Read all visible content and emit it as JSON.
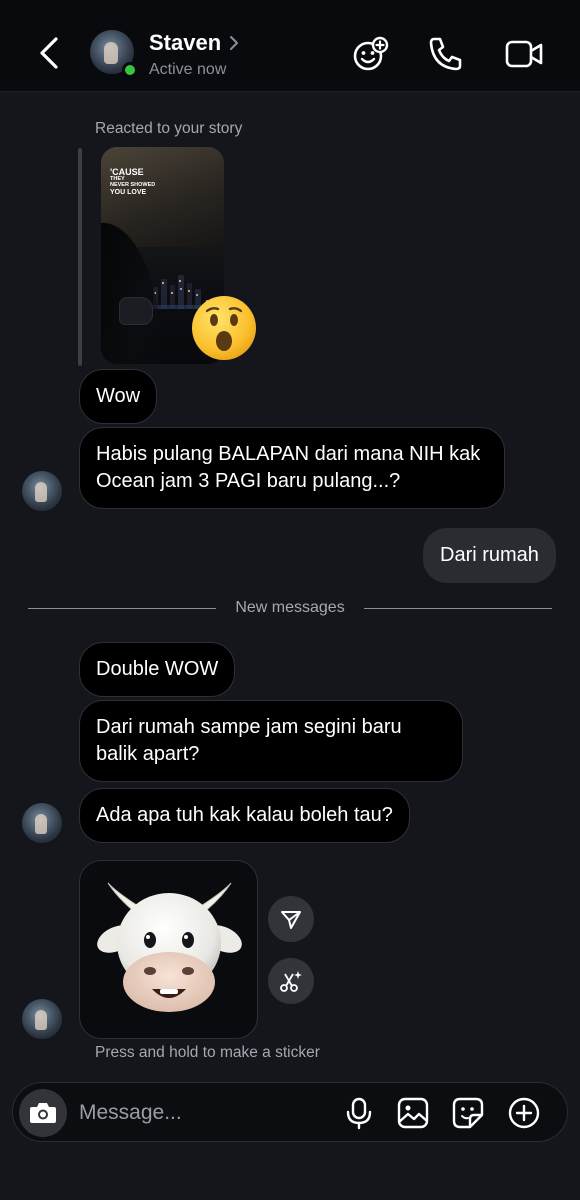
{
  "header": {
    "contact_name": "Staven",
    "status": "Active now"
  },
  "chat": {
    "story_reply_label": "Reacted to your story",
    "story_text_line1": "'CAUSE",
    "story_text_line2": "THEY",
    "story_text_line3": "NEVER SHOWED",
    "story_text_line4": "YOU LOVE",
    "reaction_icon": "astonished-face-emoji",
    "messages": [
      {
        "side": "received",
        "text": "Wow"
      },
      {
        "side": "received",
        "text": "Habis pulang BALAPAN dari mana NIH kak Ocean jam 3 PAGI baru pulang...?"
      },
      {
        "side": "sent",
        "text": "Dari rumah"
      },
      {
        "side": "received",
        "text": "Double WOW"
      },
      {
        "side": "received",
        "text": "Dari rumah sampe jam segini baru balik apart?"
      },
      {
        "side": "received",
        "text": "Ada apa tuh kak kalau boleh tau?"
      }
    ],
    "new_messages_label": "New messages",
    "sticker_icon": "cow-memoji-sticker",
    "sticker_hint": "Press and hold to make a sticker"
  },
  "composer": {
    "placeholder": "Message..."
  },
  "colors": {
    "background": "#14161c",
    "header": "#090a0d",
    "received_bubble": "#000000",
    "sent_bubble": "#2a2c31",
    "online": "#37c53f"
  }
}
